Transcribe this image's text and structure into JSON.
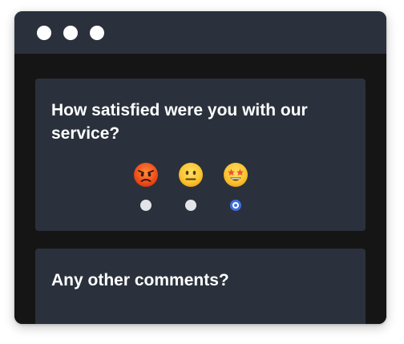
{
  "colors": {
    "window_background": "#151515",
    "card_background": "#2a313c",
    "text": "#ffffff",
    "radio_selected_accent": "#3d6fe0"
  },
  "window": {
    "controls": [
      "close-dot",
      "minimize-dot",
      "maximize-dot"
    ]
  },
  "survey": {
    "questions": [
      {
        "text": "How satisfied were you with our service?",
        "type": "rating",
        "options": [
          {
            "icon": "angry-face-icon",
            "selected": false
          },
          {
            "icon": "neutral-face-icon",
            "selected": false
          },
          {
            "icon": "star-struck-face-icon",
            "selected": true
          }
        ]
      },
      {
        "text": "Any other comments?",
        "type": "text",
        "value": ""
      }
    ]
  }
}
